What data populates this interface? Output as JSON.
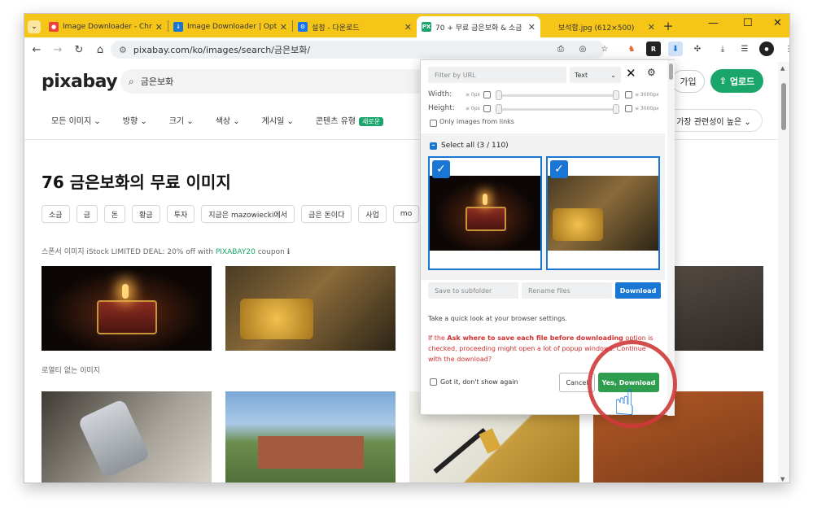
{
  "tabs": [
    {
      "title": "Image Downloader - Chro",
      "icon": "chrome-store-icon",
      "active": false
    },
    {
      "title": "Image Downloader | Optic",
      "icon": "download-ext-icon",
      "active": false
    },
    {
      "title": "설정 - 다운로드",
      "icon": "gear-icon",
      "active": false
    },
    {
      "title": "70 + 무료 금은보화 & 소금",
      "icon": "pixabay-icon",
      "active": true
    },
    {
      "title": "보석함.jpg (612×500)",
      "icon": "",
      "active": false
    }
  ],
  "new_tab": "+",
  "window_controls": {
    "minimize": "—",
    "maximize": "☐",
    "close": "✕"
  },
  "address_bar": {
    "url": "pixabay.com/ko/images/search/금은보화/"
  },
  "page": {
    "logo": "pixabay",
    "search_value": "금은보화",
    "join_label": "가입",
    "upload_label": "업로드",
    "filters": [
      "모든 이미지 ⌄",
      "방향 ⌄",
      "크기 ⌄",
      "색상 ⌄",
      "게시일 ⌄",
      "콘텐츠 유형"
    ],
    "new_badge": "새로운",
    "sort_label": "가장 관련성이 높은 ⌄",
    "heading": "76 금은보화의 무료 이미지",
    "chips": [
      "소금",
      "금",
      "돈",
      "황금",
      "투자",
      "지금은 mazowiecki에서",
      "금은 돈이다",
      "사업",
      "mo"
    ],
    "sponsor_text": "스폰서 이미지 iStock LIMITED DEAL: 20% off with",
    "sponsor_code": "PIXABAY20",
    "sponsor_suffix": "coupon ℹ",
    "royalty_free": "로열티 없는 이미지"
  },
  "extension": {
    "filter_placeholder": "Filter by URL",
    "filter_type": "Text",
    "width_label": "Width:",
    "height_label": "Height:",
    "min_px": "≥ 0px",
    "max_px": "≤ 3000px",
    "only_links": "Only images from links",
    "select_all": "Select all (3 / 110)",
    "subfolder_placeholder": "Save to subfolder",
    "rename_placeholder": "Rename files",
    "download_label": "Download",
    "settings_hint": "Take a quick look at your browser settings.",
    "warning_prefix": "If the",
    "warning_bold": "Ask where to save each file before downloading",
    "warning_suffix": "option is checked, proceeding might open a lot of popup windows. Continue with the download?",
    "got_it": "Got it, don't show again",
    "cancel_label": "Cancel",
    "yes_label": "Yes, Download"
  },
  "colors": {
    "tabstrip": "#f5c518",
    "brand_green": "#1aa56b",
    "ext_blue": "#1976d2",
    "yes_green": "#2e9d4d",
    "warning_red": "#d32f2f",
    "highlight_ring": "#cf3a3a"
  }
}
